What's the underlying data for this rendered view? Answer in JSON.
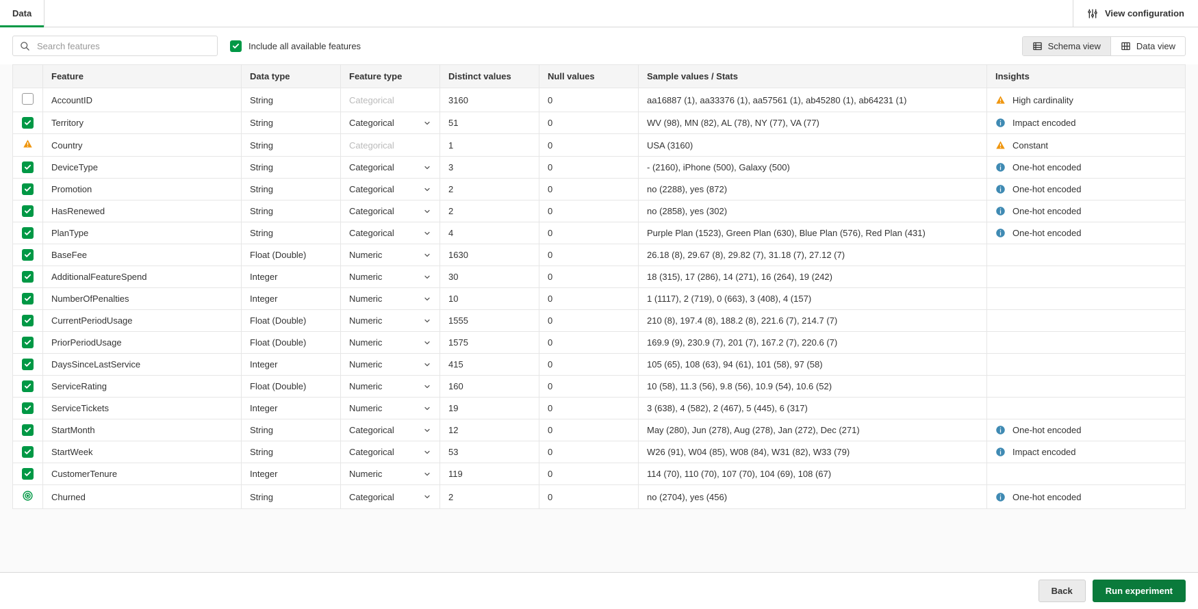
{
  "tabs": {
    "data": "Data"
  },
  "header": {
    "view_config": "View configuration"
  },
  "toolbar": {
    "search_placeholder": "Search features",
    "include_all_label": "Include all available features",
    "schema_view": "Schema view",
    "data_view": "Data view"
  },
  "columns": {
    "feature": "Feature",
    "data_type": "Data type",
    "feature_type": "Feature type",
    "distinct": "Distinct values",
    "null": "Null values",
    "sample": "Sample values / Stats",
    "insights": "Insights"
  },
  "rows": [
    {
      "sel": "unchecked",
      "name": "AccountID",
      "dtype": "String",
      "ftype": "Categorical",
      "ftype_muted": true,
      "distinct": "3160",
      "null": "0",
      "sample": "aa16887 (1), aa33376 (1), aa57561 (1), ab45280 (1), ab64231 (1)",
      "insight_icon": "warn",
      "insight": "High cardinality"
    },
    {
      "sel": "checked",
      "name": "Territory",
      "dtype": "String",
      "ftype": "Categorical",
      "distinct": "51",
      "null": "0",
      "sample": "WV (98), MN (82), AL (78), NY (77), VA (77)",
      "insight_icon": "info",
      "insight": "Impact encoded"
    },
    {
      "sel": "warn",
      "name": "Country",
      "dtype": "String",
      "ftype": "Categorical",
      "ftype_muted": true,
      "distinct": "1",
      "null": "0",
      "sample": "USA (3160)",
      "insight_icon": "warn",
      "insight": "Constant"
    },
    {
      "sel": "checked",
      "name": "DeviceType",
      "dtype": "String",
      "ftype": "Categorical",
      "distinct": "3",
      "null": "0",
      "sample": "- (2160), iPhone (500), Galaxy (500)",
      "insight_icon": "info",
      "insight": "One-hot encoded"
    },
    {
      "sel": "checked",
      "name": "Promotion",
      "dtype": "String",
      "ftype": "Categorical",
      "distinct": "2",
      "null": "0",
      "sample": "no (2288), yes (872)",
      "insight_icon": "info",
      "insight": "One-hot encoded"
    },
    {
      "sel": "checked",
      "name": "HasRenewed",
      "dtype": "String",
      "ftype": "Categorical",
      "distinct": "2",
      "null": "0",
      "sample": "no (2858), yes (302)",
      "insight_icon": "info",
      "insight": "One-hot encoded"
    },
    {
      "sel": "checked",
      "name": "PlanType",
      "dtype": "String",
      "ftype": "Categorical",
      "distinct": "4",
      "null": "0",
      "sample": "Purple Plan (1523), Green Plan (630), Blue Plan (576), Red Plan (431)",
      "insight_icon": "info",
      "insight": "One-hot encoded"
    },
    {
      "sel": "checked",
      "name": "BaseFee",
      "dtype": "Float (Double)",
      "ftype": "Numeric",
      "distinct": "1630",
      "null": "0",
      "sample": "26.18 (8), 29.67 (8), 29.82 (7), 31.18 (7), 27.12 (7)",
      "insight_icon": "",
      "insight": ""
    },
    {
      "sel": "checked",
      "name": "AdditionalFeatureSpend",
      "dtype": "Integer",
      "ftype": "Numeric",
      "distinct": "30",
      "null": "0",
      "sample": "18 (315), 17 (286), 14 (271), 16 (264), 19 (242)",
      "insight_icon": "",
      "insight": ""
    },
    {
      "sel": "checked",
      "name": "NumberOfPenalties",
      "dtype": "Integer",
      "ftype": "Numeric",
      "distinct": "10",
      "null": "0",
      "sample": "1 (1117), 2 (719), 0 (663), 3 (408), 4 (157)",
      "insight_icon": "",
      "insight": ""
    },
    {
      "sel": "checked",
      "name": "CurrentPeriodUsage",
      "dtype": "Float (Double)",
      "ftype": "Numeric",
      "distinct": "1555",
      "null": "0",
      "sample": "210 (8), 197.4 (8), 188.2 (8), 221.6 (7), 214.7 (7)",
      "insight_icon": "",
      "insight": ""
    },
    {
      "sel": "checked",
      "name": "PriorPeriodUsage",
      "dtype": "Float (Double)",
      "ftype": "Numeric",
      "distinct": "1575",
      "null": "0",
      "sample": "169.9 (9), 230.9 (7), 201 (7), 167.2 (7), 220.6 (7)",
      "insight_icon": "",
      "insight": ""
    },
    {
      "sel": "checked",
      "name": "DaysSinceLastService",
      "dtype": "Integer",
      "ftype": "Numeric",
      "distinct": "415",
      "null": "0",
      "sample": "105 (65), 108 (63), 94 (61), 101 (58), 97 (58)",
      "insight_icon": "",
      "insight": ""
    },
    {
      "sel": "checked",
      "name": "ServiceRating",
      "dtype": "Float (Double)",
      "ftype": "Numeric",
      "distinct": "160",
      "null": "0",
      "sample": "10 (58), 11.3 (56), 9.8 (56), 10.9 (54), 10.6 (52)",
      "insight_icon": "",
      "insight": ""
    },
    {
      "sel": "checked",
      "name": "ServiceTickets",
      "dtype": "Integer",
      "ftype": "Numeric",
      "distinct": "19",
      "null": "0",
      "sample": "3 (638), 4 (582), 2 (467), 5 (445), 6 (317)",
      "insight_icon": "",
      "insight": ""
    },
    {
      "sel": "checked",
      "name": "StartMonth",
      "dtype": "String",
      "ftype": "Categorical",
      "distinct": "12",
      "null": "0",
      "sample": "May (280), Jun (278), Aug (278), Jan (272), Dec (271)",
      "insight_icon": "info",
      "insight": "One-hot encoded"
    },
    {
      "sel": "checked",
      "name": "StartWeek",
      "dtype": "String",
      "ftype": "Categorical",
      "distinct": "53",
      "null": "0",
      "sample": "W26 (91), W04 (85), W08 (84), W31 (82), W33 (79)",
      "insight_icon": "info",
      "insight": "Impact encoded"
    },
    {
      "sel": "checked",
      "name": "CustomerTenure",
      "dtype": "Integer",
      "ftype": "Numeric",
      "distinct": "119",
      "null": "0",
      "sample": "114 (70), 110 (70), 107 (70), 104 (69), 108 (67)",
      "insight_icon": "",
      "insight": ""
    },
    {
      "sel": "target",
      "name": "Churned",
      "dtype": "String",
      "ftype": "Categorical",
      "distinct": "2",
      "null": "0",
      "sample": "no (2704), yes (456)",
      "insight_icon": "info",
      "insight": "One-hot encoded"
    }
  ],
  "footer": {
    "back": "Back",
    "run": "Run experiment"
  }
}
